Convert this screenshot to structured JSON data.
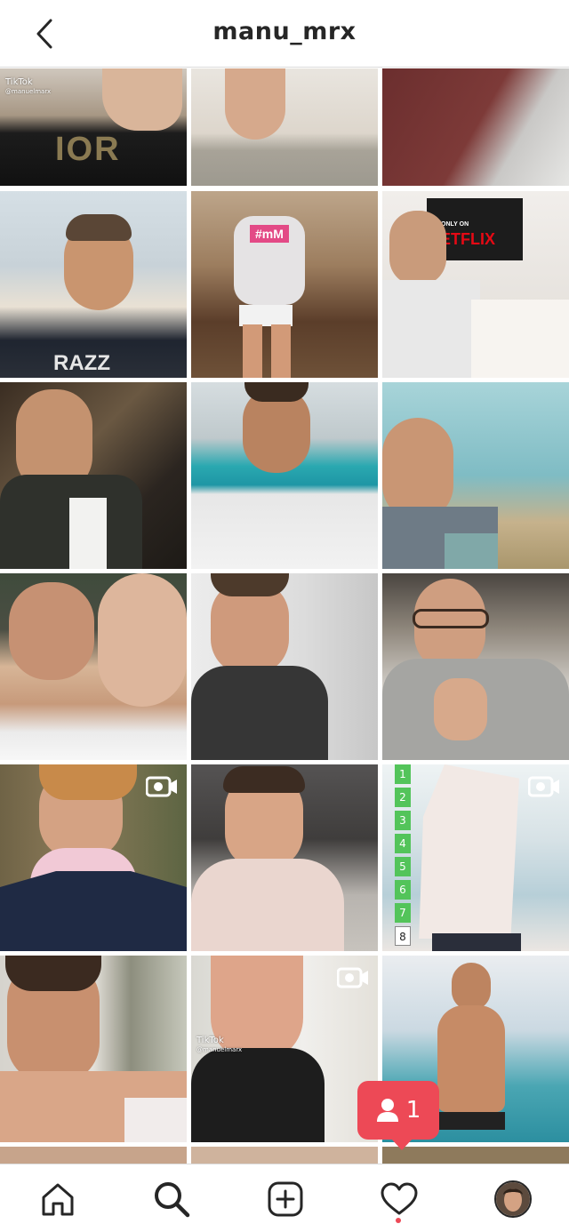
{
  "header": {
    "title": "manu_mrx",
    "back_icon": "chevron-left-icon"
  },
  "posts": [
    {
      "kind": "photo",
      "tiktok_label": "TikTok",
      "tiktok_handle": "@manuelmarx",
      "shirt_text": "IOR"
    },
    {
      "kind": "photo"
    },
    {
      "kind": "photo"
    },
    {
      "kind": "photo",
      "shirt_text": "RAZZ"
    },
    {
      "kind": "photo",
      "hoodie_text": "#mM"
    },
    {
      "kind": "photo",
      "sign_top": "ONLY ON",
      "sign_text": "NETFLIX"
    },
    {
      "kind": "photo"
    },
    {
      "kind": "photo"
    },
    {
      "kind": "photo"
    },
    {
      "kind": "photo"
    },
    {
      "kind": "photo"
    },
    {
      "kind": "photo"
    },
    {
      "kind": "video",
      "badge_icon": "video-icon"
    },
    {
      "kind": "photo"
    },
    {
      "kind": "video",
      "badge_icon": "video-icon",
      "steps": [
        "1",
        "2",
        "3",
        "4",
        "5",
        "6",
        "7",
        "8"
      ]
    },
    {
      "kind": "photo"
    },
    {
      "kind": "video",
      "badge_icon": "video-icon",
      "tiktok_label": "TikTok",
      "tiktok_handle": "@manuelmarx"
    },
    {
      "kind": "photo"
    }
  ],
  "notification": {
    "icon": "user-icon",
    "count": "1"
  },
  "tabs": [
    "home-icon",
    "search-icon",
    "add-post-icon",
    "activity-heart-icon",
    "profile-avatar"
  ],
  "colors": {
    "accent": "#ed4956",
    "text": "#262626",
    "divider": "#dbdbdb"
  }
}
